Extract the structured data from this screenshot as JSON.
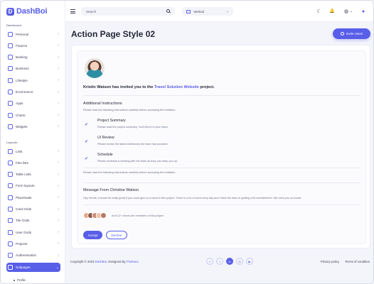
{
  "brand": {
    "name": "DashBoi",
    "mark": "D"
  },
  "sidebar": {
    "section_dashboard": "Dashboard",
    "section_layouts": "Layouts",
    "dashboard_items": [
      {
        "label": "Personal"
      },
      {
        "label": "Finance"
      },
      {
        "label": "Banking"
      },
      {
        "label": "Business"
      },
      {
        "label": "Lifestyle"
      },
      {
        "label": "Ecommerce"
      },
      {
        "label": "Apps"
      },
      {
        "label": "Charts"
      },
      {
        "label": "Widgets"
      }
    ],
    "layout_items": [
      {
        "label": "Lists"
      },
      {
        "label": "Flex lists"
      },
      {
        "label": "Table Lists"
      },
      {
        "label": "Form layouts"
      },
      {
        "label": "Placeloads"
      },
      {
        "label": "Card Grids"
      },
      {
        "label": "Tile Grids"
      },
      {
        "label": "User Grids"
      },
      {
        "label": "Projects"
      },
      {
        "label": "Authentication"
      },
      {
        "label": "Subpages"
      }
    ],
    "sub_items": [
      {
        "label": "Profile"
      }
    ],
    "chevron": "›",
    "chevron_open": "⌄"
  },
  "header": {
    "search_placeholder": "Search",
    "layout_select": "Vertical",
    "layout_chev": "⌄",
    "icons": {
      "theme": "☾",
      "bell": "🔔",
      "globe": "◍",
      "globe_chev": "⌄",
      "avatar": "●"
    }
  },
  "page": {
    "title": "Action Page Style 02",
    "invite_button": "Invite Users"
  },
  "card": {
    "invite_prefix": "Kristin Watson has invited you to the ",
    "project_name": "Travel Solution Website",
    "invite_suffix": " project.",
    "instructions_title": "Additional Instructions",
    "instructions_note": "Please read the following instructions carefully before accepting the invitation.",
    "steps": [
      {
        "check": "✔",
        "title": "Project Summary",
        "desc": "Please read the project summary. You'll find it in your inbox."
      },
      {
        "check": "✔",
        "title": "UI Review",
        "desc": "Please review the latest wireframes the team has provided."
      },
      {
        "check": "✔",
        "title": "Schedule",
        "desc": "Please schedule a meeting with the team as they can ramp you up."
      }
    ],
    "follow_note": "Please read the following instructions carefully before accepting the invitation.",
    "message_title": "Message From Christine Watson",
    "message_body": "Hey Henrik, it would be really great if you could give us a hand in this project. There is a lot of work every day and I think the team is getting a bit overwhelmed. We need you on board.",
    "members_text": "And 12+ others are members of this project",
    "member_colors": [
      "#e7a48b",
      "#8a5a4a",
      "#c98f7a",
      "#f0c1a7",
      "#b77b67"
    ],
    "accept_button": "Accept",
    "decline_button": "Decline"
  },
  "footer": {
    "copyright_prefix": "Copyright © 2023 ",
    "copyright_brand1": "DashBoi",
    "copyright_mid": ". Designed By ",
    "copyright_brand2": "Pixelwex",
    "socials": [
      {
        "name": "facebook-icon",
        "glyph": "f"
      },
      {
        "name": "twitter-icon",
        "glyph": "t"
      },
      {
        "name": "linkedin-icon",
        "glyph": "in"
      },
      {
        "name": "instagram-icon",
        "glyph": "◎"
      },
      {
        "name": "youtube-icon",
        "glyph": "▶"
      }
    ],
    "privacy": "Privacy policy",
    "terms": "Terms of condition"
  }
}
